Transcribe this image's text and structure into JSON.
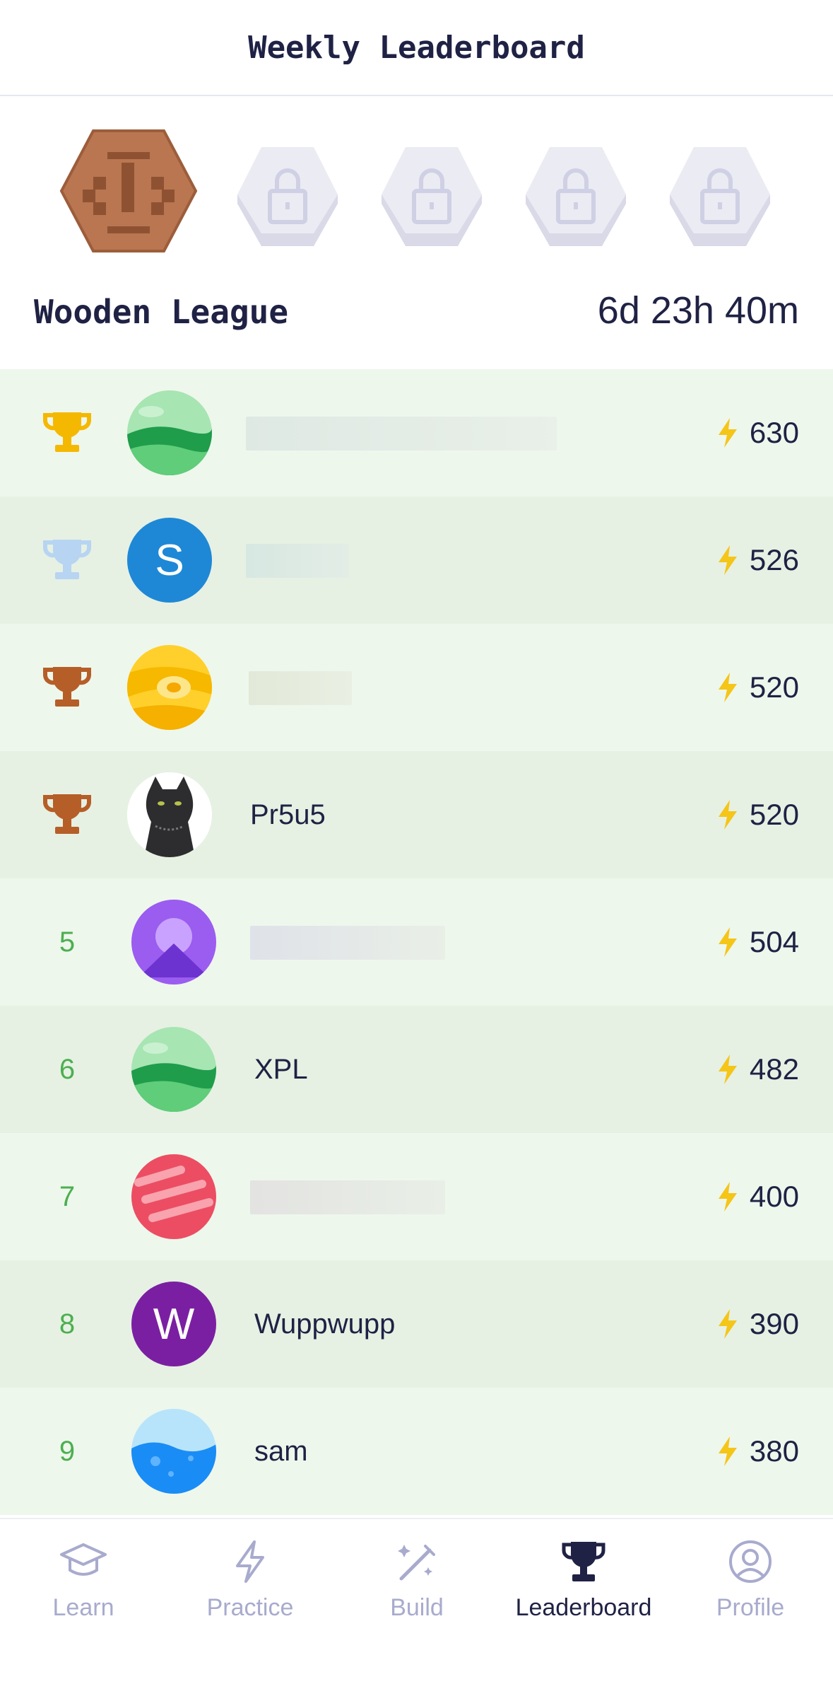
{
  "header": {
    "title": "Weekly Leaderboard"
  },
  "league": {
    "name": "Wooden League",
    "countdown": "6d 23h 40m",
    "badges": [
      "wooden-league-badge",
      "locked-badge",
      "locked-badge",
      "locked-badge",
      "locked-badge"
    ]
  },
  "leaderboard": [
    {
      "rank": "1",
      "rank_icon": "gold-trophy-icon",
      "avatar": "green-planet-avatar",
      "name": "",
      "score": "630"
    },
    {
      "rank": "2",
      "rank_icon": "silver-trophy-icon",
      "avatar": "letter-avatar",
      "avatar_letter": "S",
      "avatar_color": "#1e88e5",
      "name": "",
      "score": "526"
    },
    {
      "rank": "3",
      "rank_icon": "bronze-trophy-icon",
      "avatar": "yellow-planet-avatar",
      "name": "",
      "score": "520"
    },
    {
      "rank": "4",
      "rank_icon": "bronze-trophy-icon",
      "avatar": "cat-photo-avatar",
      "name": "Pr5u5",
      "score": "520"
    },
    {
      "rank": "5",
      "avatar": "purple-mountain-avatar",
      "name": "",
      "score": "504"
    },
    {
      "rank": "6",
      "avatar": "green-planet-avatar",
      "name": "XPL",
      "score": "482"
    },
    {
      "rank": "7",
      "avatar": "red-planet-avatar",
      "name": "",
      "score": "400"
    },
    {
      "rank": "8",
      "avatar": "letter-avatar",
      "avatar_letter": "W",
      "avatar_color": "#7b1fa2",
      "name": "Wuppwupp",
      "score": "390"
    },
    {
      "rank": "9",
      "avatar": "blue-water-avatar",
      "name": "sam",
      "score": "380"
    }
  ],
  "tabs": [
    {
      "label": "Learn",
      "icon": "graduation-cap-icon",
      "active": false
    },
    {
      "label": "Practice",
      "icon": "lightning-icon",
      "active": false
    },
    {
      "label": "Build",
      "icon": "magic-wand-icon",
      "active": false
    },
    {
      "label": "Leaderboard",
      "icon": "trophy-icon",
      "active": true
    },
    {
      "label": "Profile",
      "icon": "user-circle-icon",
      "active": false
    }
  ],
  "colors": {
    "text": "#1f2244",
    "rank_number": "#4caf50",
    "bolt": "#f5c518",
    "inactive_tab": "#a8abcd",
    "row_light": "#eef7ec",
    "row_dark": "#e6f1e3"
  }
}
